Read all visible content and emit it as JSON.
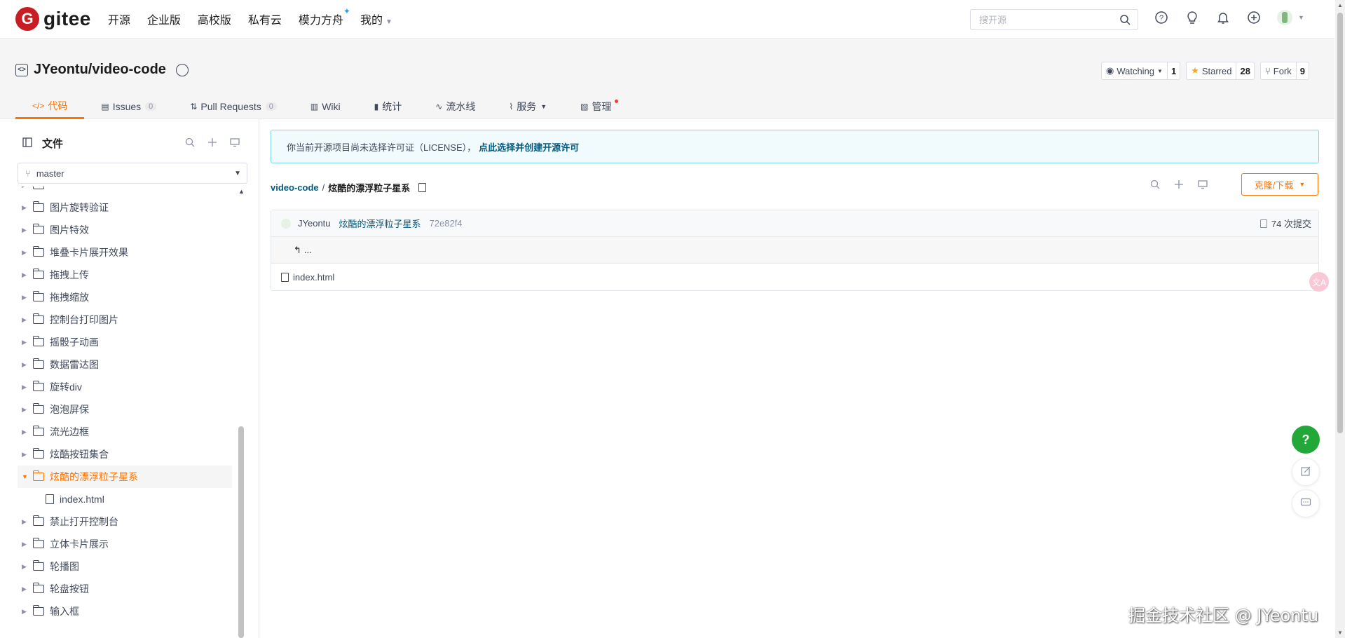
{
  "nav": {
    "logo_letter": "G",
    "logo_text": "gitee",
    "items": [
      {
        "label": "开源"
      },
      {
        "label": "企业版"
      },
      {
        "label": "高校版"
      },
      {
        "label": "私有云"
      },
      {
        "label": "模力方舟"
      },
      {
        "label": "我的"
      }
    ],
    "search_placeholder": "搜开源"
  },
  "repo": {
    "path": "JYeontu/video-code",
    "watching_label": "Watching",
    "watching_count": "1",
    "starred_label": "Starred",
    "starred_count": "28",
    "fork_label": "Fork",
    "fork_count": "9"
  },
  "tabs": [
    {
      "label": "代码",
      "icon": "code-icon",
      "count": ""
    },
    {
      "label": "Issues",
      "icon": "issue-icon",
      "count": "0"
    },
    {
      "label": "Pull Requests",
      "icon": "pr-icon",
      "count": "0"
    },
    {
      "label": "Wiki",
      "icon": "wiki-icon",
      "count": ""
    },
    {
      "label": "统计",
      "icon": "chart-icon",
      "count": ""
    },
    {
      "label": "流水线",
      "icon": "pipeline-icon",
      "count": ""
    },
    {
      "label": "服务",
      "icon": "service-icon",
      "count": ""
    },
    {
      "label": "管理",
      "icon": "admin-icon",
      "count": ""
    }
  ],
  "sidebar": {
    "title": "文件",
    "branch": "master",
    "tree": [
      {
        "label": "图片旋转验证"
      },
      {
        "label": "图片特效"
      },
      {
        "label": "堆叠卡片展开效果"
      },
      {
        "label": "拖拽上传"
      },
      {
        "label": "拖拽缩放"
      },
      {
        "label": "控制台打印图片"
      },
      {
        "label": "摇骰子动画"
      },
      {
        "label": "数据雷达图"
      },
      {
        "label": "旋转div"
      },
      {
        "label": "泡泡屏保"
      },
      {
        "label": "流光边框"
      },
      {
        "label": "炫酷按钮集合"
      },
      {
        "label": "炫酷的漂浮粒子星系"
      },
      {
        "label": "index.html"
      },
      {
        "label": "禁止打开控制台"
      },
      {
        "label": "立体卡片展示"
      },
      {
        "label": "轮播图"
      },
      {
        "label": "轮盘按钮"
      },
      {
        "label": "输入框"
      }
    ]
  },
  "main": {
    "notice_text": "你当前开源项目尚未选择许可证（LICENSE），",
    "notice_link": "点此选择并创建开源许可",
    "crumb_root": "video-code",
    "crumb_sep": "/",
    "crumb_current": "炫酷的漂浮粒子星系",
    "clone_label": "克隆/下载",
    "commit_author": "JYeontu",
    "commit_message": "炫酷的漂浮粒子星系",
    "commit_sha": "72e82f4",
    "commit_count": "74 次提交",
    "up_label": "...",
    "files": [
      {
        "name": "index.html"
      }
    ]
  },
  "float": {
    "translate_label": "文A",
    "help_label": "?"
  },
  "watermark": "掘金技术社区 @ JYeontu",
  "colors": {
    "brand": "#c71d23",
    "accent": "#fe7300",
    "link": "#005980",
    "help_green": "#21a838",
    "notice_border": "#7fd5e8"
  }
}
